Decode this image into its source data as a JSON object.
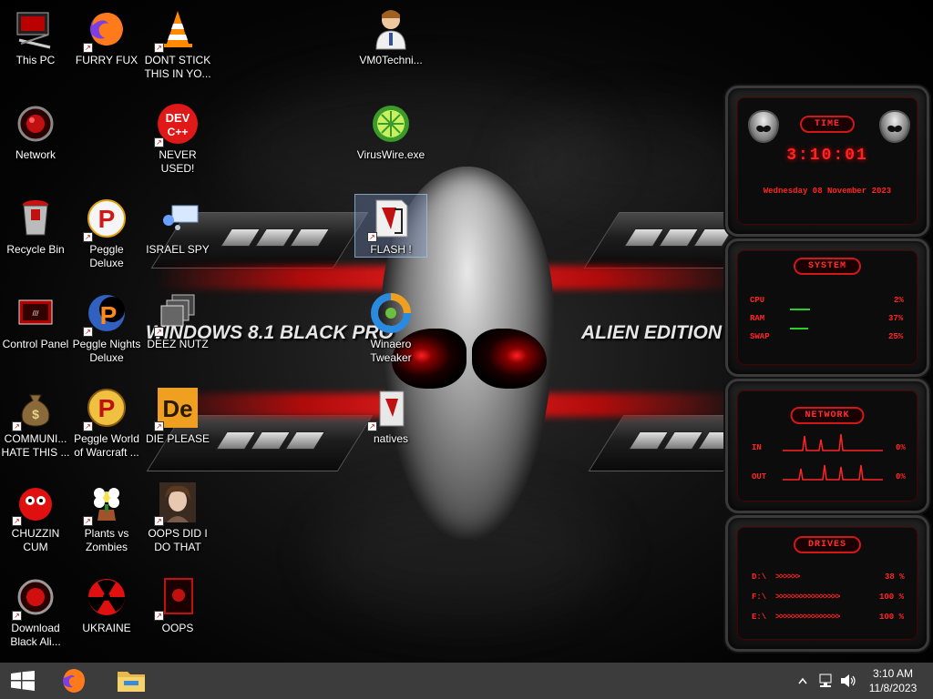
{
  "desktop": {
    "wallpaper_text_left": "WINDOWS 8.1 BLACK PRO",
    "wallpaper_text_right": "ALIEN EDITION 20"
  },
  "icons": [
    {
      "label": "This PC",
      "icon": "this-pc-icon"
    },
    {
      "label": "FURRY FUX",
      "icon": "firefox-icon"
    },
    {
      "label": "DONT STICK THIS IN YO...",
      "icon": "vlc-cone-icon"
    },
    {
      "label": "VM0Techni...",
      "icon": "technician-icon"
    },
    {
      "label": "Network",
      "icon": "network-icon"
    },
    {
      "label": "NEVER USED!",
      "icon": "dev-cpp-icon"
    },
    {
      "label": "VirusWire.exe",
      "icon": "limewire-icon"
    },
    {
      "label": "Recycle Bin",
      "icon": "recycle-bin-icon"
    },
    {
      "label": "Peggle Deluxe",
      "icon": "peggle-icon"
    },
    {
      "label": "ISRAEL SPY",
      "icon": "spy-icon"
    },
    {
      "label": "FLASH !",
      "icon": "flash-folder-icon"
    },
    {
      "label": "Control Panel",
      "icon": "control-panel-icon"
    },
    {
      "label": "Peggle Nights Deluxe",
      "icon": "peggle-nights-icon"
    },
    {
      "label": "DEEZ NUTZ",
      "icon": "stacked-windows-icon"
    },
    {
      "label": "Winaero Tweaker",
      "icon": "winaero-icon"
    },
    {
      "label": "COMMUNI... HATE THIS ...",
      "icon": "money-bag-icon"
    },
    {
      "label": "Peggle World of Warcraft ...",
      "icon": "peggle-wow-icon"
    },
    {
      "label": "DIE PLEASE",
      "icon": "die-icon"
    },
    {
      "label": "natives",
      "icon": "natives-folder-icon"
    },
    {
      "label": "CHUZZIN CUM",
      "icon": "chuzzle-icon"
    },
    {
      "label": "Plants vs Zombies",
      "icon": "pvz-icon"
    },
    {
      "label": "OOPS DID I DO THAT",
      "icon": "portrait-icon"
    },
    {
      "label": "Download Black Ali...",
      "icon": "download-alien-icon"
    },
    {
      "label": "UKRAINE",
      "icon": "radiation-icon"
    },
    {
      "label": "OOPS",
      "icon": "oops-icon"
    }
  ],
  "widgets": {
    "time": {
      "title": "TIME",
      "clock": "3:10:01",
      "date": "Wednesday 08 November 2023"
    },
    "system": {
      "title": "SYSTEM",
      "cpu_label": "CPU",
      "cpu_value": "2%",
      "cpu": 0.02,
      "ram_label": "RAM",
      "ram_value": "37%",
      "ram": 0.37,
      "swap_label": "SWAP",
      "swap_value": "25%",
      "swap": 0.25
    },
    "network": {
      "title": "NETWORK",
      "in_label": "IN",
      "in_value": "0%",
      "out_label": "OUT",
      "out_value": "0%"
    },
    "drives": {
      "title": "DRIVES",
      "items": [
        {
          "label": "D:\\",
          "value": "38 %"
        },
        {
          "label": "F:\\",
          "value": "100 %"
        },
        {
          "label": "E:\\",
          "value": "100 %"
        }
      ]
    }
  },
  "taskbar": {
    "time": "3:10 AM",
    "date": "11/8/2023",
    "start_icon": "windows-start-icon",
    "pinned": [
      "firefox-icon",
      "file-explorer-icon"
    ],
    "tray": [
      "chevron-up-icon",
      "network-tray-icon",
      "volume-icon"
    ]
  }
}
